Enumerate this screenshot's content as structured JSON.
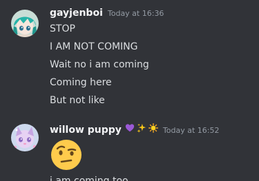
{
  "messages": [
    {
      "username": "gayjenboi",
      "timestamp": "Today at 16:36",
      "lines": [
        "STOP",
        "I AM NOT COMING",
        "Wait no i am coming",
        "Coming here",
        "But not like"
      ]
    },
    {
      "username": "willow puppy",
      "badges": [
        "purple-heart-icon",
        "sparkles-icon",
        "sun-icon"
      ],
      "timestamp": "Today at 16:52",
      "emoji": "face-with-raised-eyebrow-icon",
      "lines": [
        "i am coming too"
      ]
    }
  ],
  "colors": {
    "background": "#313338",
    "username": "#f2f3f5",
    "timestamp": "#949ba4",
    "text": "#dbdee1"
  }
}
